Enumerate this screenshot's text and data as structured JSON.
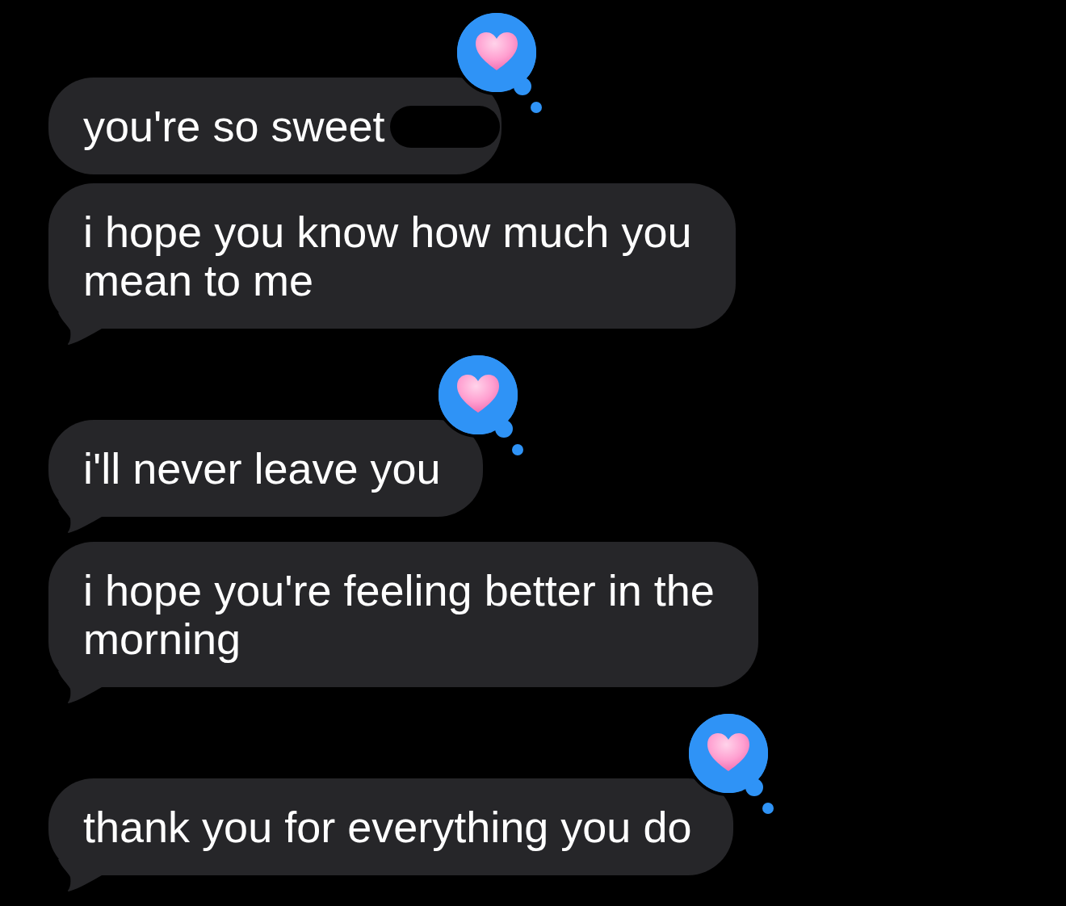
{
  "messages": [
    {
      "text": "you're so sweet",
      "redacted": true,
      "tail": false,
      "loved": true
    },
    {
      "text": "i hope you know how much you mean to me",
      "redacted": false,
      "tail": true,
      "loved": false
    },
    {
      "text": "i'll never leave you",
      "redacted": false,
      "tail": true,
      "loved": true
    },
    {
      "text": "i hope you're feeling better in the morning",
      "redacted": false,
      "tail": true,
      "loved": false
    },
    {
      "text": "thank you for everything you do",
      "redacted": false,
      "tail": true,
      "loved": true
    }
  ]
}
